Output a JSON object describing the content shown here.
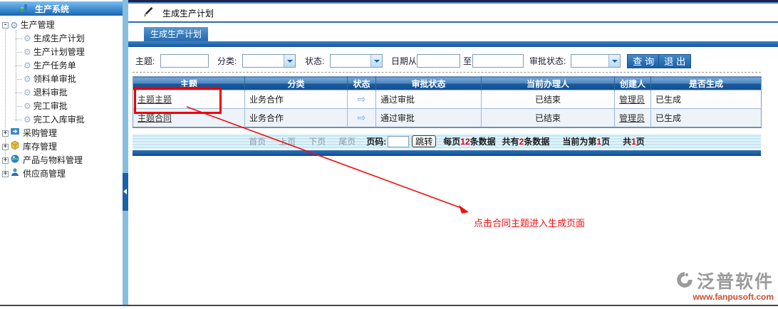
{
  "colors": {
    "accent_blue": "#1a66b0",
    "table_header_blue": "#134f90",
    "highlight_red": "#ee0000",
    "watermark_orange": "#cd4f2e"
  },
  "sidebar": {
    "title": "生产系统",
    "root": {
      "label": "生产管理"
    },
    "children": [
      {
        "label": "生成生产计划"
      },
      {
        "label": "生产计划管理"
      },
      {
        "label": "生产任务单"
      },
      {
        "label": "领料单审批"
      },
      {
        "label": "退料审批"
      },
      {
        "label": "完工审批"
      },
      {
        "label": "完工入库审批"
      }
    ],
    "modules": [
      {
        "label": "采购管理"
      },
      {
        "label": "库存管理"
      },
      {
        "label": "产品与物料管理"
      },
      {
        "label": "供应商管理"
      }
    ]
  },
  "main": {
    "page_title": "生成生产计划",
    "tab": "生成生产计划",
    "filters": {
      "subject_label": "主题:",
      "category_label": "分类:",
      "status_label": "状态:",
      "date_from_label": "日期从",
      "date_to_label": "至",
      "approval_label": "审批状态:",
      "search_button": "查 询",
      "exit_button": "退 出"
    },
    "table": {
      "columns": [
        "主题",
        "分类",
        "状态",
        "审批状态",
        "当前办理人",
        "创建人",
        "是否生成"
      ],
      "status_arrow": "⇨",
      "rows": [
        {
          "subject": "主题主题",
          "category": "业务合作",
          "approval": "通过审批",
          "handler": "已结束",
          "creator": "管理员",
          "generated": "已生成"
        },
        {
          "subject": "主题合同",
          "category": "业务合作",
          "approval": "通过审批",
          "handler": "已结束",
          "creator": "管理员",
          "generated": "已生成"
        }
      ]
    },
    "pagination": {
      "first": "首页",
      "prev": "上页",
      "next": "下页",
      "last": "尾页",
      "page_label": "页码:",
      "jump_button": "跳转",
      "per_page_prefix": "每页",
      "per_page_num": "12",
      "per_page_suffix": "条数据",
      "total_prefix": "共有",
      "total_num": "2",
      "total_suffix": "条数据",
      "current_prefix": "当前为第",
      "current_num": "1",
      "current_suffix": "页",
      "pages_prefix": "共",
      "pages_num": "1",
      "pages_suffix": "页"
    },
    "annotation": "点击合同主题进入生成页面"
  },
  "watermark": {
    "brand": "泛普软件",
    "url": "www.fanpusoft.com"
  }
}
